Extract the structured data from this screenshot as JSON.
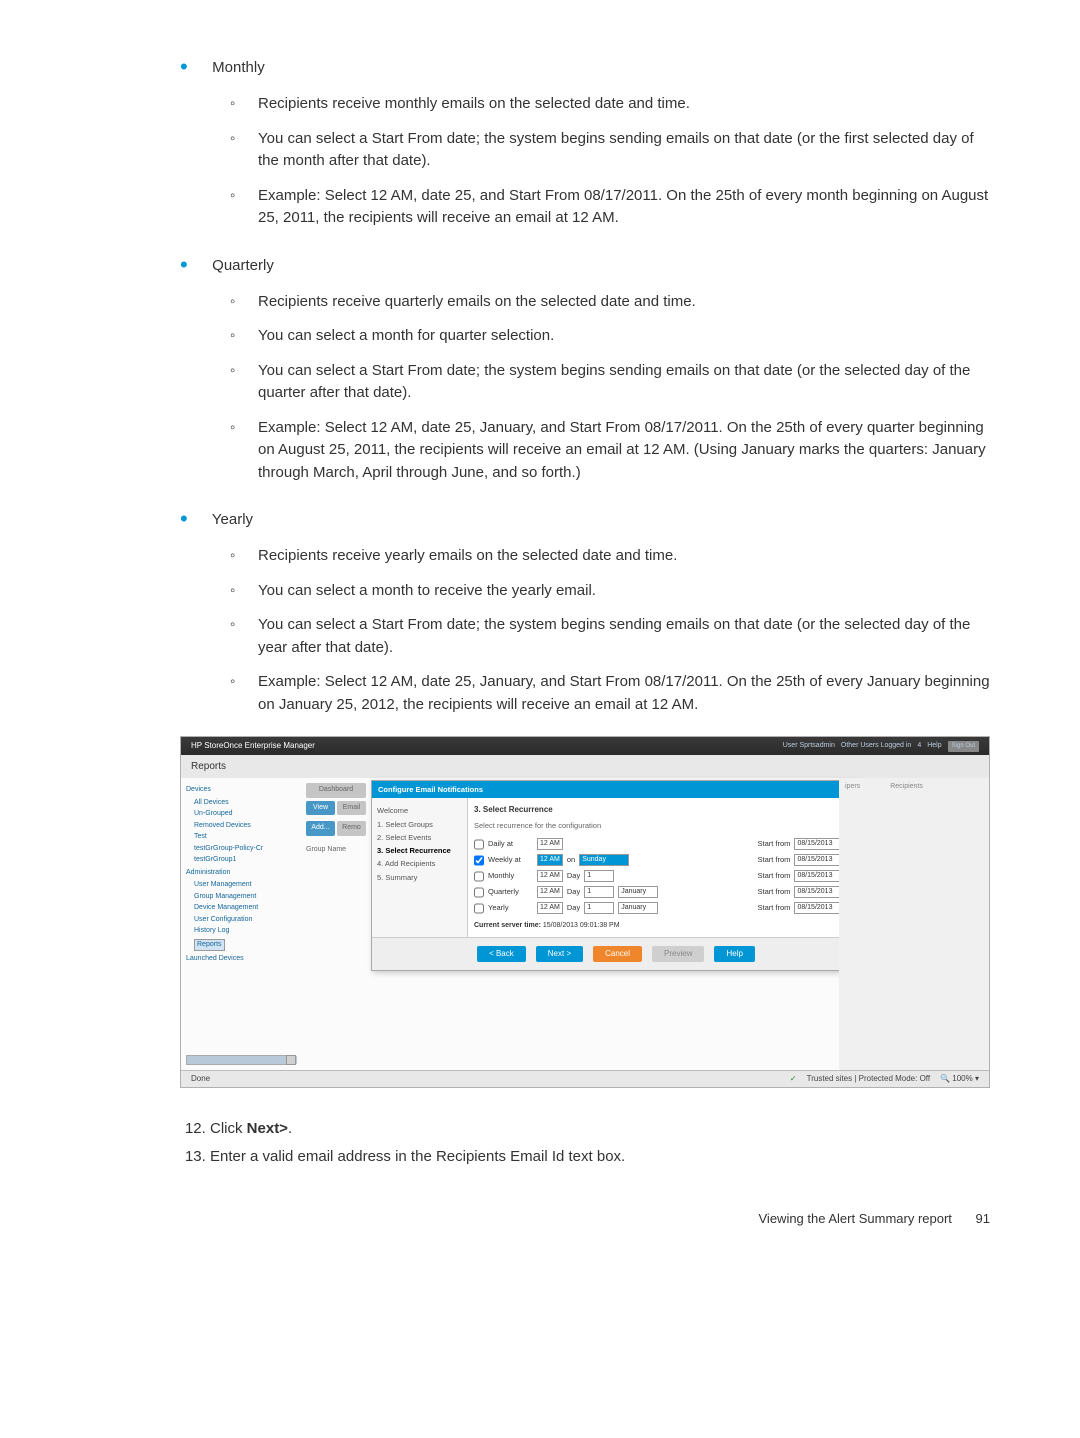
{
  "doc": {
    "monthly": {
      "title": "Monthly",
      "b1": "Recipients receive monthly emails on the selected date and time.",
      "b2": "You can select a Start From date; the system begins sending emails on that date (or the first selected day of the month after that date).",
      "b3": "Example: Select 12 AM, date 25, and Start From 08/17/2011. On the 25th of every month beginning on August 25, 2011, the recipients will receive an email at 12 AM."
    },
    "quarterly": {
      "title": "Quarterly",
      "b1": "Recipients receive quarterly emails on the selected date and time.",
      "b2": "You can select a month for quarter selection.",
      "b3": "You can select a Start From date; the system begins sending emails on that date (or the selected day of the quarter after that date).",
      "b4": "Example: Select 12 AM, date 25, January, and Start From 08/17/2011. On the 25th of every quarter beginning on August 25, 2011, the recipients will receive an email at 12 AM. (Using January marks the quarters: January through March, April through June, and so forth.)"
    },
    "yearly": {
      "title": "Yearly",
      "b1": "Recipients receive yearly emails on the selected date and time.",
      "b2": "You can select a month to receive the yearly email.",
      "b3": "You can select a Start From date; the system begins sending emails on that date (or the selected day of the year after that date).",
      "b4": "Example: Select 12 AM, date 25, January, and Start From 08/17/2011. On the 25th of every January beginning on January 25, 2012, the recipients will receive an email at 12 AM."
    },
    "step12a": "Click ",
    "step12b": "Next>",
    "step12c": ".",
    "step13": "Enter a valid email address in the Recipients Email Id text box.",
    "footer_text": "Viewing the Alert Summary report",
    "footer_page": "91"
  },
  "ui": {
    "app_title": "HP StoreOnce Enterprise Manager",
    "top_right": {
      "a": "User Sprtsadmin",
      "b": "Other Users Logged in",
      "c": "4",
      "d": "Help",
      "e": "Sign Out"
    },
    "reports": "Reports",
    "nav": {
      "devices": "Devices",
      "alldev": "All Devices",
      "ungrouped": "Un-Grouped",
      "removed": "Removed Devices",
      "test": "Test",
      "testgp": "testGrGroup-Policy-Cr",
      "testg1": "testGrGroup1",
      "admin": "Administration",
      "usermgmt": "User Management",
      "groupmgmt": "Group Management",
      "devmgmt": "Device Management",
      "userconf": "User Configuration",
      "history": "History Log",
      "reportsnav": "Reports",
      "launched": "Launched Devices"
    },
    "ribbon": {
      "dashboard": "Dashboard",
      "view": "View",
      "email": "Email",
      "add": "Add...",
      "remo": "Remo",
      "groupname": "Group Name"
    },
    "dialog": {
      "title": "Configure Email Notifications",
      "steps": {
        "welcome": "Welcome",
        "s1": "1. Select Groups",
        "s2": "2. Select Events",
        "s3": "3. Select Recurrence",
        "s4": "4. Add Recipients",
        "s5": "5. Summary"
      },
      "heading": "3. Select Recurrence",
      "subtitle": "Select recurrence for the configuration",
      "rows": {
        "daily": {
          "name": "Daily at",
          "time": "12 AM",
          "sf": "Start from",
          "date": "08/15/2013"
        },
        "weekly": {
          "name": "Weekly at",
          "time": "12 AM",
          "on": "on",
          "day": "Sunday",
          "sf": "Start from",
          "date": "08/15/2013"
        },
        "monthly": {
          "name": "Monthly",
          "time": "12 AM",
          "daylbl": "Day",
          "dayv": "1",
          "sf": "Start from",
          "date": "08/15/2013"
        },
        "quarterly": {
          "name": "Quarterly",
          "time": "12 AM",
          "daylbl": "Day",
          "dayv": "1",
          "month": "January",
          "sf": "Start from",
          "date": "08/15/2013"
        },
        "yearly": {
          "name": "Yearly",
          "time": "12 AM",
          "daylbl": "Day",
          "dayv": "1",
          "month": "January",
          "sf": "Start from",
          "date": "08/15/2013"
        }
      },
      "server_time_lbl": "Current server time:",
      "server_time_val": "15/08/2013 09:01:38 PM",
      "buttons": {
        "back": "< Back",
        "next": "Next >",
        "cancel": "Cancel",
        "preview": "Preview",
        "help": "Help"
      }
    },
    "rightpanel": {
      "ipers": "ipers",
      "recipients": "Recipients"
    },
    "status": {
      "done": "Done",
      "trusted": "Trusted sites | Protected Mode: Off",
      "zoom": "100%"
    }
  }
}
